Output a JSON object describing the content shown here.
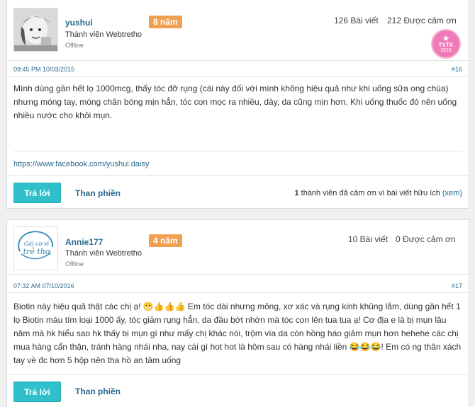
{
  "posts": [
    {
      "username": "yushui",
      "years_badge": "8 năm",
      "user_title": "Thành viên Webtretho",
      "status": "Offline",
      "post_count": "126 Bài viết",
      "thanks_count": "212 Được cảm ơn",
      "award_badge": {
        "line1": "TVTK",
        "line2": "2018"
      },
      "timestamp": "09:45 PM 10/03/2015",
      "post_number": "#16",
      "content": "Mình dùng gần hết lọ 1000mcg, thấy tóc đỡ rụng (cái này đối với mình không hiệu quả như khi uống sữa ong chúa) nhưng móng tay, móng chân bóng mịn hẳn, tóc con mọc ra nhiều, dày, da cũng mịn hơn. Khi uống thuốc đó nên uống nhiều nước cho khỏi mụn.",
      "signature": "https://www.facebook.com/yushui.daisy",
      "reply_label": "Trả lời",
      "complain_label": "Than phiền",
      "thanks_number": "1",
      "thanks_text": "thành viên đã cảm ơn vì bài viết hữu ích",
      "thanks_link": "(xem)"
    },
    {
      "username": "Annie177",
      "years_badge": "4 năm",
      "user_title": "Thành viên Webtretho",
      "status": "Offline",
      "post_count": "10 Bài viết",
      "thanks_count": "0 Được cảm ơn",
      "avatar_text": {
        "line1": "Gái cơ vì",
        "line2": "trẻ thơ"
      },
      "timestamp": "07:32 AM 07/10/2016",
      "post_number": "#17",
      "content_parts": {
        "a": "Biotin này hiệu quả thật các chị ạ! ",
        "b": " Em tóc dài nhưng mỏng, xơ xác và rụng kinh khủng lắm, dùng gần hết 1 lọ Biotin màu tím loại 1000 ấy, tóc giảm rụng hẳn, da đầu bớt nhờn mà tóc con lên tua tua ạ! Cơ địa e là bị mụn lâu năm mà hk hiểu sao hk thấy bị mụn gì như mấy chị khác nói, trộm vía da còn hồng hào giảm mụn hơn hehehe các chị mua hàng cẩn thận, tránh hàng nhái nha, nay cái gì hot hot là hôm sau có hàng nhái liền ",
        "c": "! Em có ng thân xách tay về đc hơn 5 hộp nên tha hồ an tâm uống"
      },
      "emoji_a": "😁👍👍👍",
      "emoji_c": "😂😂😂",
      "reply_label": "Trả lời",
      "complain_label": "Than phiền"
    }
  ],
  "colors": {
    "accent": "#30c0cc",
    "badge": "#f0a050",
    "link": "#2a6a8e",
    "award": "#f07ab8"
  }
}
